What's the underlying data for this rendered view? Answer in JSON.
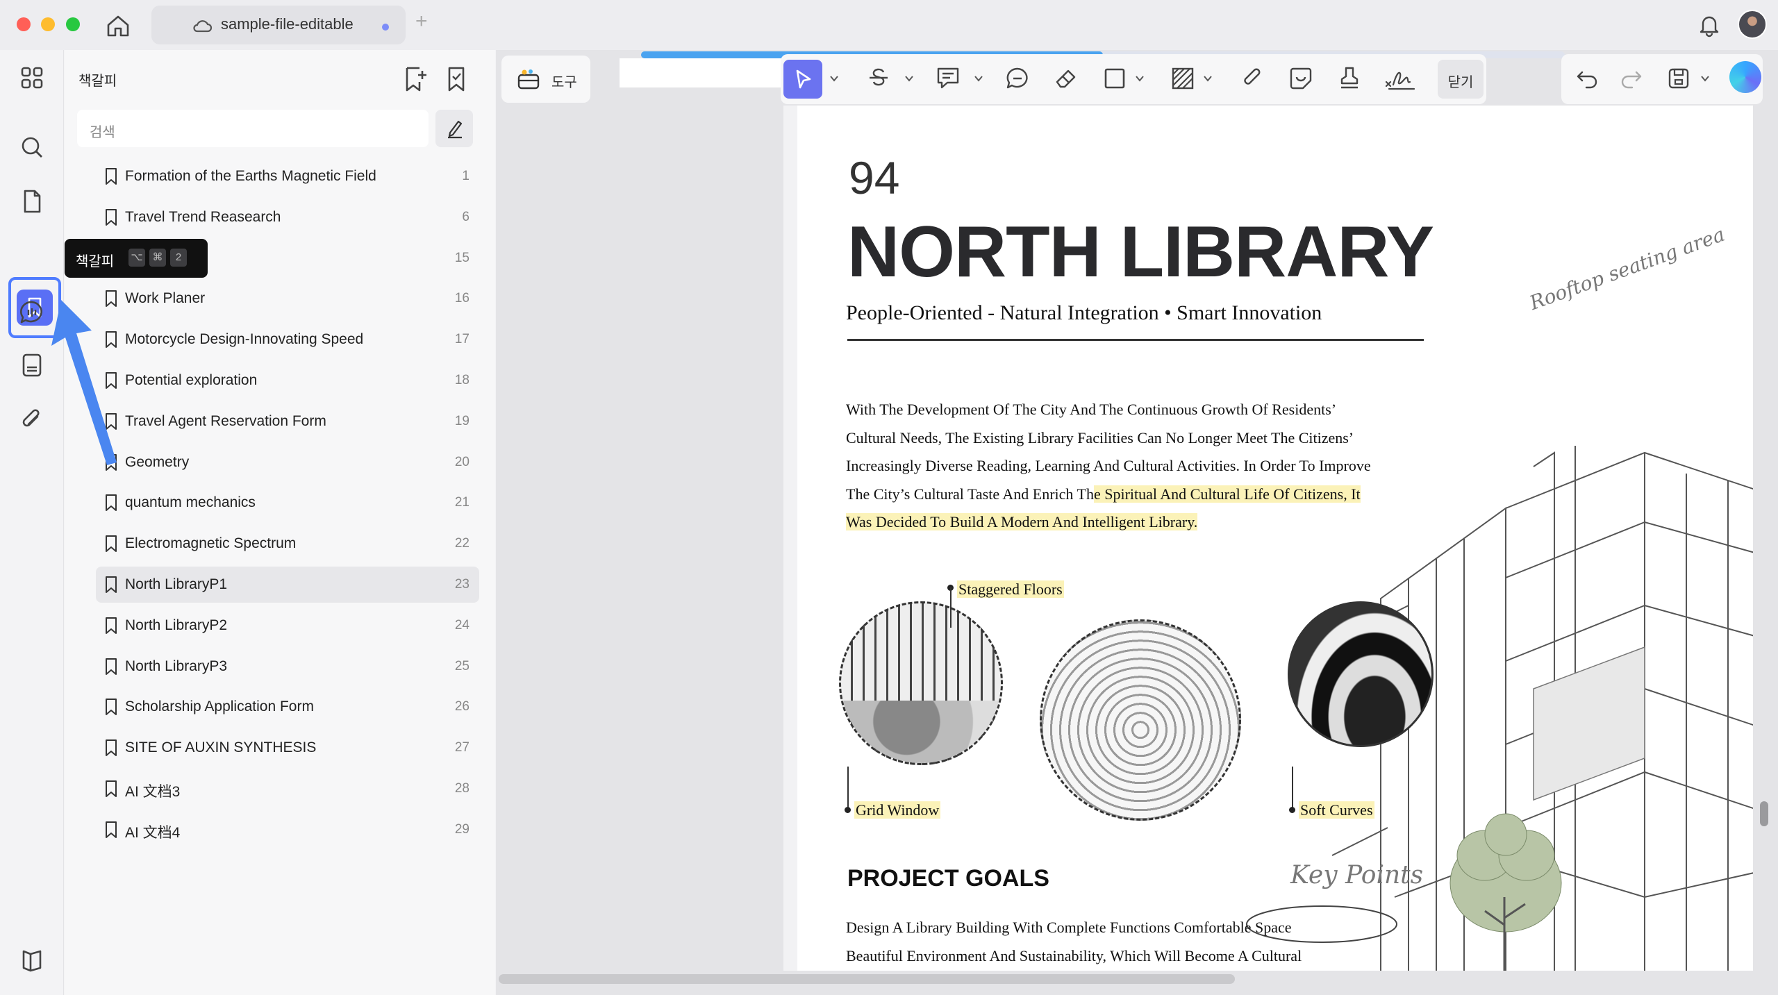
{
  "titlebar": {
    "tab_title": "sample-file-editable",
    "add_tab": "+"
  },
  "sidebar": {
    "title": "책갈피",
    "search_placeholder": "검색",
    "tooltip": {
      "label": "책갈피",
      "keys": [
        "⌥",
        "⌘",
        "2"
      ]
    },
    "items": [
      {
        "label": "Formation of the Earths Magnetic Field",
        "page": "1"
      },
      {
        "label": "Travel Trend Reasearch",
        "page": "6"
      },
      {
        "label": "",
        "page": "15"
      },
      {
        "label": "Work Planer",
        "page": "16"
      },
      {
        "label": "Motorcycle Design-Innovating Speed",
        "page": "17"
      },
      {
        "label": "Potential exploration",
        "page": "18"
      },
      {
        "label": "Travel Agent Reservation Form",
        "page": "19"
      },
      {
        "label": "Geometry",
        "page": "20"
      },
      {
        "label": "quantum mechanics",
        "page": "21"
      },
      {
        "label": "Electromagnetic Spectrum",
        "page": "22"
      },
      {
        "label": "North LibraryP1",
        "page": "23"
      },
      {
        "label": "North LibraryP2",
        "page": "24"
      },
      {
        "label": "North LibraryP3",
        "page": "25"
      },
      {
        "label": "Scholarship Application Form",
        "page": "26"
      },
      {
        "label": "SITE OF AUXIN SYNTHESIS",
        "page": "27"
      },
      {
        "label": "AI 文档3",
        "page": "28"
      },
      {
        "label": "AI 文档4",
        "page": "29"
      }
    ],
    "selected_index": 10
  },
  "toolbar": {
    "tools_label": "도구",
    "close_label": "닫기"
  },
  "reading_progress": 0.5,
  "document": {
    "page_number": "94",
    "title": "NORTH LIBRARY",
    "subtitle": "People-Oriented - Natural Integration • Smart Innovation",
    "body_lines": [
      "With The Development Of The City And The Continuous Growth Of Residents’",
      "Cultural Needs, The Existing Library Facilities Can No Longer Meet The Citizens’",
      "Increasingly Diverse Reading, Learning And Cultural Activities. In Order To Improve"
    ],
    "body_line4_plain": "The City’s Cultural Taste And Enrich Th",
    "body_line4_highlight": "e Spiritual And Cultural Life Of Citizens, It",
    "body_line5_highlight": "Was Decided To Build A Modern And Intelligent Library.",
    "captions": {
      "staggered": "Staggered Floors",
      "grid": "Grid Window",
      "soft": "Soft Curves"
    },
    "rooftop": "Rooftop seating area",
    "project_goals": "PROJECT GOALS",
    "key_points": "Key Points",
    "goals_lines": [
      "Design A Library Building With Complete Functions Comfortable Space",
      "Beautiful Environment And Sustainability, Which Will Become A Cultural"
    ]
  }
}
